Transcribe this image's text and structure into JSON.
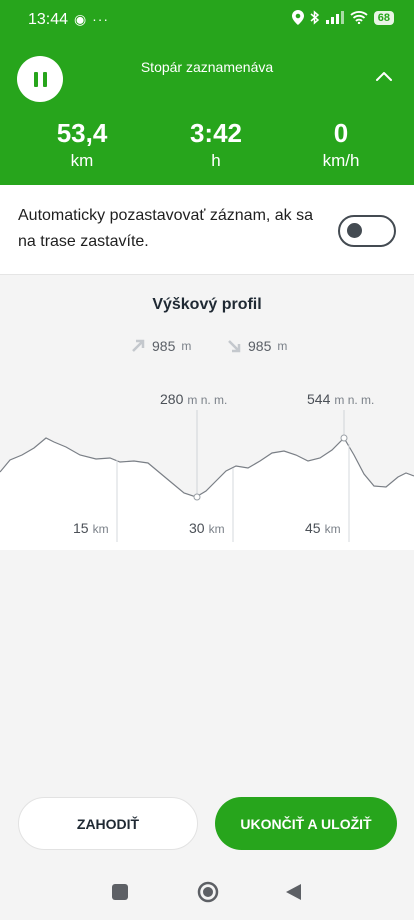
{
  "status": {
    "time": "13:44",
    "left_icons": [
      "messenger-icon",
      "more-dots-icon"
    ],
    "right_icons": [
      "location-icon",
      "bluetooth-icon",
      "signal-icon",
      "wifi-icon"
    ],
    "battery": "68"
  },
  "recording": {
    "title": "Stopár zaznamenáva",
    "stats": [
      {
        "value": "53,4",
        "unit": "km"
      },
      {
        "value": "3:42",
        "unit": "h"
      },
      {
        "value": "0",
        "unit": "km/h"
      }
    ]
  },
  "auto_pause": {
    "text": "Automaticky pozastavovať záznam, ak sa na trase zastavíte.",
    "enabled": false
  },
  "profile": {
    "title": "Výškový profil",
    "ascent": "985",
    "descent": "985",
    "elev_unit": "m",
    "min_label": {
      "value": "280",
      "unit": "m n. m."
    },
    "max_label": {
      "value": "544",
      "unit": "m n. m."
    },
    "distance_labels": [
      {
        "value": "15",
        "unit": "km"
      },
      {
        "value": "30",
        "unit": "km"
      },
      {
        "value": "45",
        "unit": "km"
      }
    ],
    "colors": {
      "line": "#7a7f86",
      "fill": "#ffffff",
      "marker": "#cfd3d8"
    }
  },
  "actions": {
    "discard": "ZAHODIŤ",
    "save": "UKONČIŤ A ULOŽIŤ"
  },
  "nav": [
    "recents-square-icon",
    "home-circle-icon",
    "back-triangle-icon"
  ],
  "colors": {
    "accent": "#27a51c"
  }
}
